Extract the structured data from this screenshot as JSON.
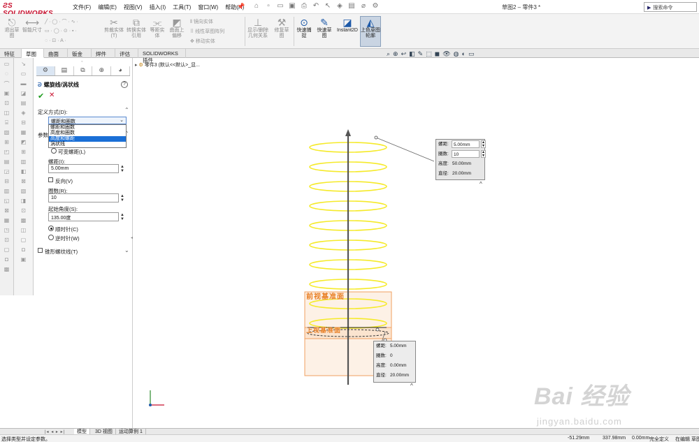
{
  "app": {
    "logo_text": "SOLIDWORKS",
    "doc_title": "草图2 – 零件3 *",
    "search_placeholder": "搜索命令"
  },
  "menu": [
    "文件(F)",
    "编辑(E)",
    "视图(V)",
    "插入(I)",
    "工具(T)",
    "窗口(W)",
    "帮助(H)"
  ],
  "ribbon": {
    "exit_sketch": "退出草图",
    "smart_dimension": "智能尺寸",
    "trim": "剪裁实体(T)",
    "convert": "转换实体引用",
    "offset": "等距实体",
    "offset_surface": "曲面上偏移",
    "mirror": "镜向实体",
    "linear_pattern": "线性草图阵列",
    "move": "移动实体",
    "display_relations": "显示/删除几何关系",
    "repair_sketch": "修复草图",
    "quick_snaps": "快速捕捉",
    "rapid_sketch": "快速草图",
    "instant2d": "Instant2D",
    "shaded_contours": "上色草图轮廓"
  },
  "tabs": [
    "特征",
    "草图",
    "曲面",
    "钣金",
    "焊件",
    "评估",
    "SOLIDWORKS 插件"
  ],
  "selected_tab": "草图",
  "tree": {
    "root": "零件3 (默认<<默认>_显..."
  },
  "property_manager": {
    "title": "螺旋线/涡状线",
    "section_define": "定义方式(D):",
    "define_value": "螺距和圈数",
    "define_options": [
      "螺距和圈数",
      "高度和圈数",
      "高度和螺距",
      "涡状线"
    ],
    "define_selected_index": 2,
    "section_params": "参数",
    "variable_pitch": "可变螺距(L)",
    "pitch_label": "螺距(I):",
    "pitch_value": "5.00mm",
    "reverse_label": "反向(V)",
    "revolutions_label": "圈数(R):",
    "revolutions_value": "10",
    "start_angle_label": "起始角度(S):",
    "start_angle_value": "135.00度",
    "clockwise": "顺时针(C)",
    "counterclockwise": "逆时针(W)",
    "taper_label": "锥形螺纹线(T)"
  },
  "callout_top": {
    "rows": [
      {
        "label": "螺距:",
        "value": "5.00mm"
      },
      {
        "label": "圈数:",
        "value": "10"
      },
      {
        "label": "高度:",
        "value": "50.00mm"
      },
      {
        "label": "直径:",
        "value": "20.00mm"
      }
    ]
  },
  "callout_bottom": {
    "rows": [
      {
        "label": "螺距:",
        "value": "5.00mm"
      },
      {
        "label": "圈数:",
        "value": "0"
      },
      {
        "label": "高度:",
        "value": "0.00mm"
      },
      {
        "label": "直径:",
        "value": "20.00mm"
      }
    ]
  },
  "planes": {
    "front": "前视基准面",
    "top": "上视基准面"
  },
  "bottom_tabs": [
    "模型",
    "3D 视图",
    "运动算例 1"
  ],
  "status": {
    "message": "选择类型并设定参数。",
    "x": "-51.29mm",
    "y": "337.98mm",
    "z": "0.00mm",
    "state": "完全定义",
    "editing": "在编辑 草图"
  },
  "watermark": {
    "main": "Bai 经验",
    "sub": "jingyan.baidu.com"
  },
  "colors": {
    "helix": "#f5ea2a",
    "plane_fill": "#fdeee0",
    "plane_edge": "#f0a060",
    "accent": "#1e5aa8",
    "brand": "#c8102e"
  }
}
